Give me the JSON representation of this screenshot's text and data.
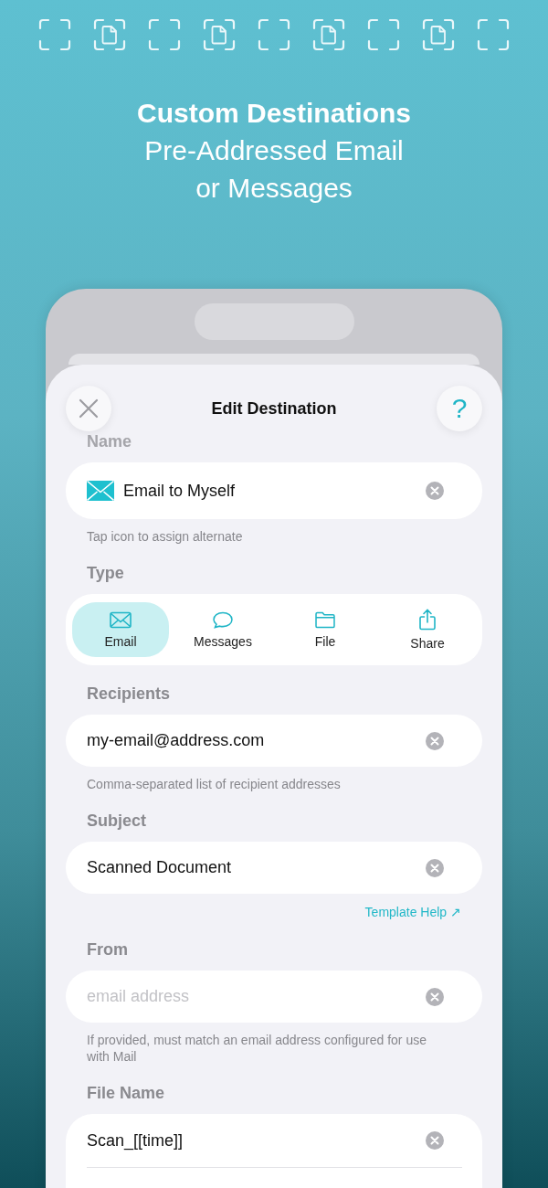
{
  "header_icons": [
    {
      "kind": "frame"
    },
    {
      "kind": "document"
    },
    {
      "kind": "frame"
    },
    {
      "kind": "document"
    },
    {
      "kind": "frame"
    },
    {
      "kind": "document"
    },
    {
      "kind": "frame"
    },
    {
      "kind": "document"
    },
    {
      "kind": "frame"
    }
  ],
  "headline": {
    "title": "Custom Destinations",
    "subtitle_lines": [
      "Pre-Addressed Email",
      "or Messages"
    ]
  },
  "sheet": {
    "title": "Edit Destination",
    "help": "?"
  },
  "form": [
    {
      "kind": "label",
      "text": "Name"
    },
    {
      "kind": "icon_field",
      "value": "Email to Myself"
    },
    {
      "kind": "hint",
      "text": "Tap icon to assign alternate"
    },
    {
      "kind": "label",
      "text": "Type"
    },
    {
      "kind": "segmented",
      "options": [
        {
          "kind": "email",
          "label": "Email",
          "selected": true
        },
        {
          "kind": "messages",
          "label": "Messages",
          "selected": false
        },
        {
          "kind": "file",
          "label": "File",
          "selected": false
        },
        {
          "kind": "share",
          "label": "Share",
          "selected": false
        }
      ]
    },
    {
      "kind": "label",
      "text": "Recipients"
    },
    {
      "kind": "field",
      "value": "my-email@address.com"
    },
    {
      "kind": "hint",
      "text": "Comma-separated list of recipient addresses"
    },
    {
      "kind": "label",
      "text": "Subject"
    },
    {
      "kind": "field",
      "value": "Scanned Document"
    },
    {
      "kind": "link",
      "text": "Template Help ↗"
    },
    {
      "kind": "label",
      "text": "From"
    },
    {
      "kind": "field",
      "placeholder": "email address"
    },
    {
      "kind": "hint",
      "text": "If provided, must match an email address configured for use with Mail"
    },
    {
      "kind": "label",
      "text": "File Name"
    },
    {
      "kind": "card_field",
      "value": "Scan_[[time]]"
    }
  ]
}
